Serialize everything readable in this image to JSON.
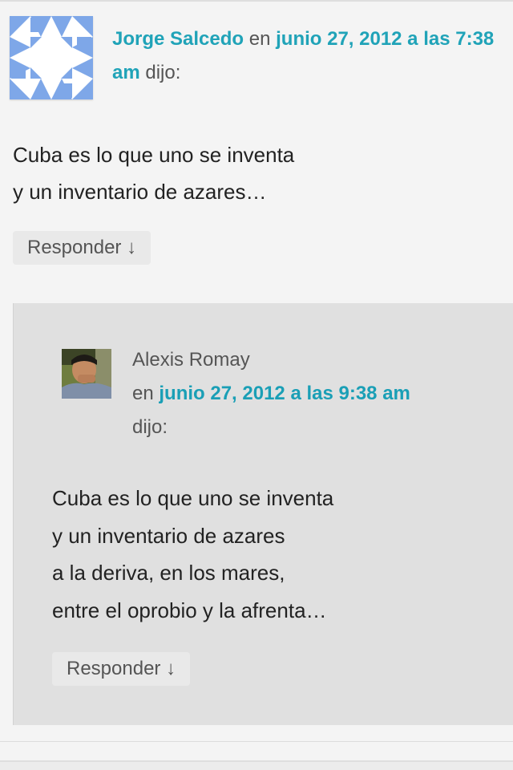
{
  "comments": [
    {
      "author": "Jorge Salcedo",
      "en_label": "en",
      "date": "junio 27, 2012 a las 7:38 am",
      "dijo_label": "dijo:",
      "body_lines": [
        "Cuba es lo que uno se inventa",
        "y un inventario de azares…"
      ],
      "reply_label": "Responder ↓",
      "avatar_icon": "identicon-avatar",
      "avatar_color": "#7ea7e8"
    },
    {
      "author": "Alexis Romay",
      "en_label": "en",
      "date": "junio 27, 2012 a las 9:38 am",
      "dijo_label": "dijo:",
      "body_lines": [
        "Cuba es lo que uno se inventa",
        "y un inventario de azares",
        "a la deriva, en los mares,",
        "entre el oprobio y la afrenta…"
      ],
      "reply_label": "Responder ↓",
      "avatar_icon": "user-photo-avatar"
    }
  ],
  "colors": {
    "link": "#20a3b8",
    "page_background": "#f4f4f4",
    "nested_background": "#e0e0e0",
    "button_background": "#e9e9e9"
  }
}
